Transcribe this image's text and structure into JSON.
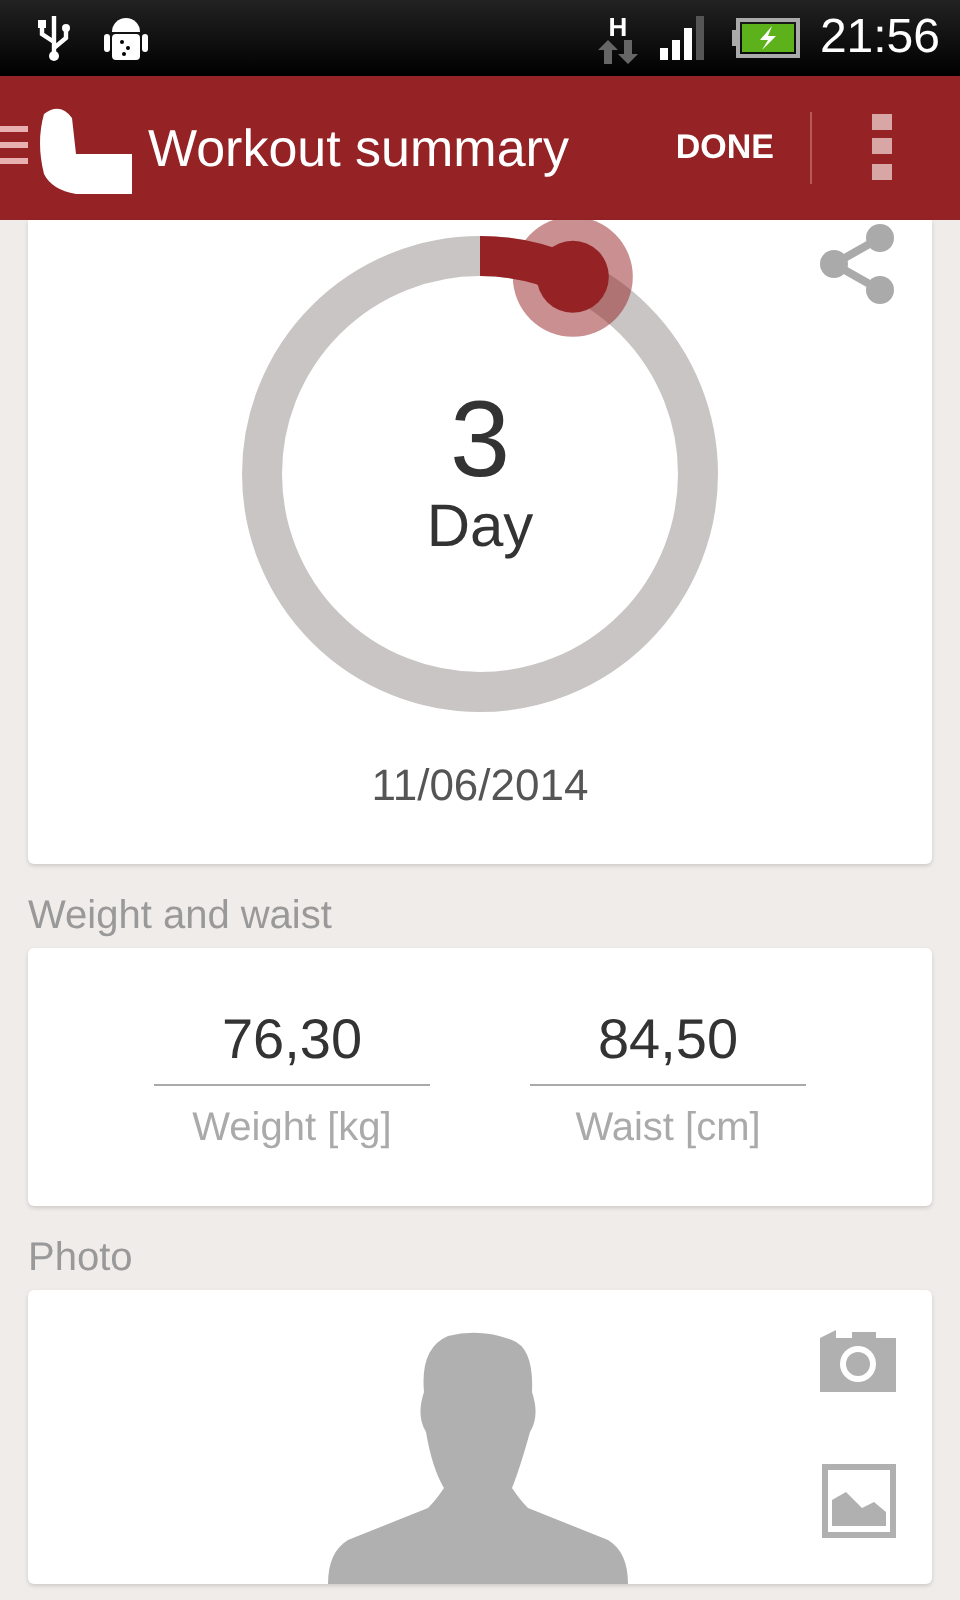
{
  "status_bar": {
    "network": "H",
    "time": "21:56"
  },
  "app_bar": {
    "title": "Workout summary",
    "action": "DONE"
  },
  "progress": {
    "number": "3",
    "unit": "Day",
    "date": "11/06/2014"
  },
  "weight_section": {
    "title": "Weight and waist",
    "fields": [
      {
        "value": "76,30",
        "label": "Weight [kg]"
      },
      {
        "value": "84,50",
        "label": "Waist [cm]"
      }
    ]
  },
  "photo_section": {
    "title": "Photo"
  }
}
